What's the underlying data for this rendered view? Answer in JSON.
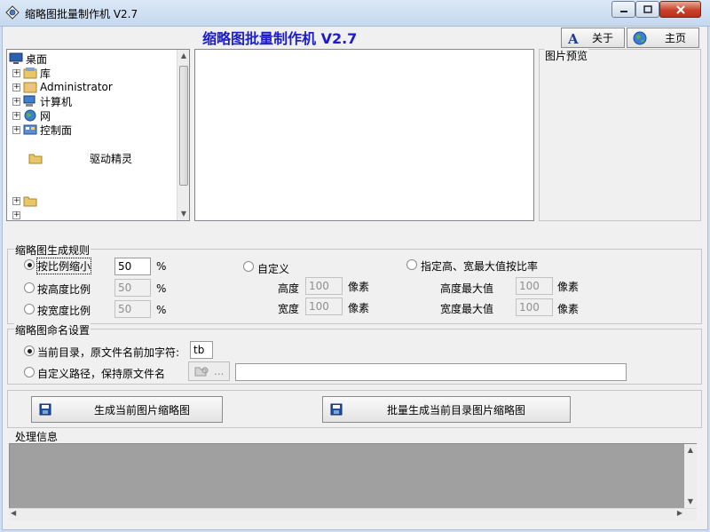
{
  "window": {
    "title": "缩略图批量制作机 V2.7"
  },
  "header": {
    "title": "缩略图批量制作机  V2.7",
    "about_label": "关于",
    "home_label": "主页"
  },
  "tree": {
    "items": [
      {
        "label": "桌面",
        "icon": "desktop-icon",
        "expander": ""
      },
      {
        "label": "库",
        "icon": "library-icon",
        "expander": "+"
      },
      {
        "label": "Administrator",
        "icon": "user-icon",
        "expander": "+"
      },
      {
        "label": "计算机",
        "icon": "computer-icon",
        "expander": "+"
      },
      {
        "label": "网",
        "icon": "network-icon",
        "expander": "+"
      },
      {
        "label": "控制面",
        "icon": "control-panel-icon",
        "expander": "+"
      },
      {
        "label": "",
        "icon": "",
        "expander": ""
      },
      {
        "label": "驱动精灵",
        "icon": "folder-icon",
        "expander": ""
      },
      {
        "label": "",
        "icon": "",
        "expander": ""
      },
      {
        "label": "",
        "icon": "",
        "expander": ""
      },
      {
        "label": "",
        "icon": "",
        "expander": ""
      },
      {
        "label": "",
        "icon": "folder-icon",
        "expander": "+"
      }
    ]
  },
  "preview": {
    "label": "图片预览"
  },
  "rules": {
    "label": "缩略图生成规则",
    "by_ratio_label": "按比例缩小",
    "by_ratio_value": "50",
    "by_height_label": "按高度比例",
    "by_height_value": "50",
    "by_width_label": "按宽度比例",
    "by_width_value": "50",
    "percent": "%",
    "custom_label": "自定义",
    "height_label": "高度",
    "height_value": "100",
    "width_label": "宽度",
    "width_value": "100",
    "pixel_unit": "像素",
    "max_label": "指定高、宽最大值按比率",
    "max_height_label": "高度最大值",
    "max_height_value": "100",
    "max_width_label": "宽度最大值",
    "max_width_value": "100",
    "pixel_unit_2": "像素"
  },
  "naming": {
    "label": "缩略图命名设置",
    "current_dir_label": "当前目录，原文件名前加字符:",
    "prefix_value": "tb",
    "custom_path_label": "自定义路径，保持原文件名",
    "browse_label": "...",
    "path_value": ""
  },
  "actions": {
    "generate_current_label": "生成当前图片缩略图",
    "batch_generate_label": "批量生成当前目录图片缩略图"
  },
  "log": {
    "label": "处理信息"
  },
  "colors": {
    "header_title": "#1c1ccc",
    "close_button": "#c8432b",
    "log_background": "#a0a0a0"
  }
}
